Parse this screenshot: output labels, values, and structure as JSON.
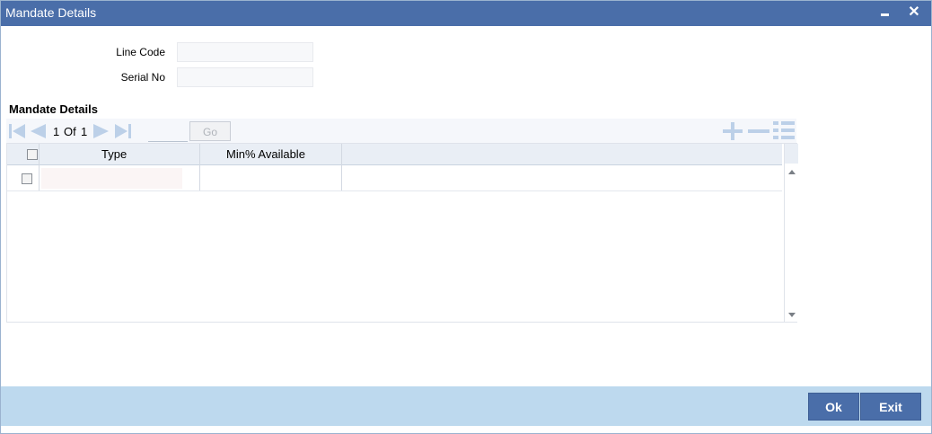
{
  "window": {
    "title": "Mandate Details"
  },
  "form": {
    "line_code_label": "Line Code",
    "line_code_value": "",
    "serial_no_label": "Serial No",
    "serial_no_value": ""
  },
  "section": {
    "title": "Mandate Details"
  },
  "pager": {
    "current": "1",
    "of_label": "Of",
    "total": "1",
    "goto_value": "",
    "go_label": "Go"
  },
  "grid": {
    "columns": [
      "Type",
      "Min% Available"
    ],
    "rows": [
      {
        "type": "",
        "min_available": ""
      }
    ]
  },
  "footer": {
    "ok_label": "Ok",
    "exit_label": "Exit"
  },
  "colors": {
    "titlebar": "#4a6ea9",
    "footer": "#bdd9ee",
    "button": "#4a6ea9",
    "toolbar_icon": "#bcd0e8"
  }
}
